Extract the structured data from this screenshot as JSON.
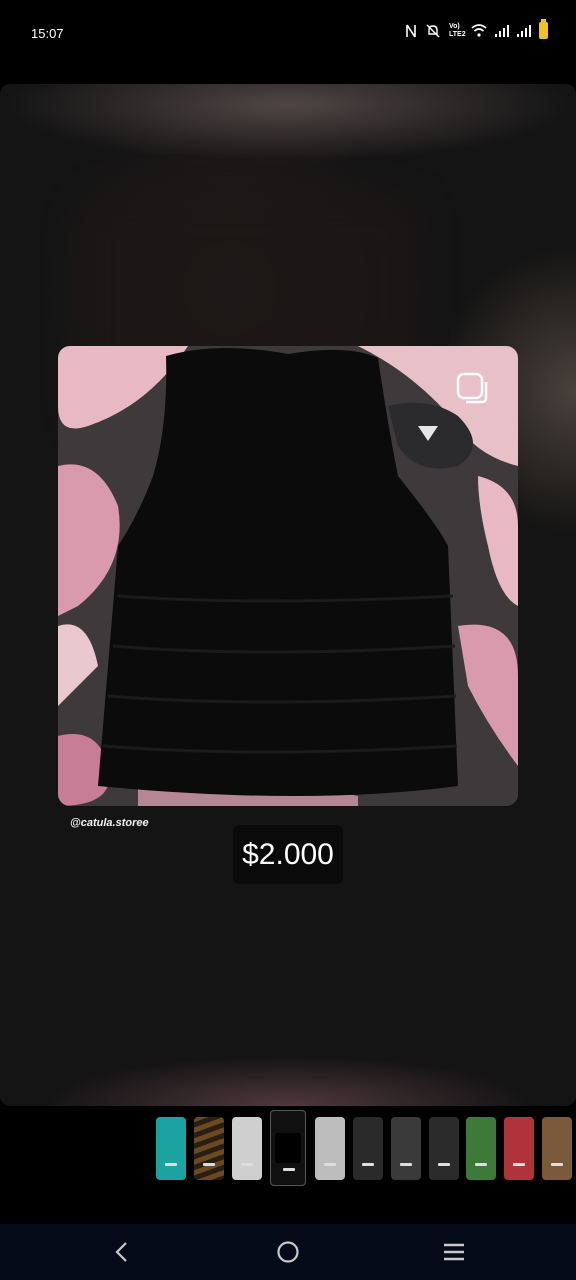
{
  "status_bar": {
    "time": "15:07",
    "icons": [
      "nfc-icon",
      "mute-icon",
      "volte-icon",
      "wifi-icon",
      "signal-icon",
      "signal-icon",
      "battery-icon"
    ],
    "network_label": "Vo) LTE2"
  },
  "story": {
    "handle": "@catula.storee",
    "price": "$2.000",
    "multi_photo_icon": "multiple-photos-icon"
  },
  "thumbnails": {
    "count": 11,
    "active_index": 3,
    "colors": [
      "#1aa3a0",
      "#6b4a22",
      "#cfcfcf",
      "#111111",
      "#bdbdbd",
      "#2a2a2a",
      "#3a3a3a",
      "#2b2b2b",
      "#3d7a3a",
      "#b0333a",
      "#7a5a3a"
    ]
  },
  "nav": {
    "back_icon": "back-icon",
    "home_icon": "home-icon",
    "recents_icon": "menu-icon"
  }
}
